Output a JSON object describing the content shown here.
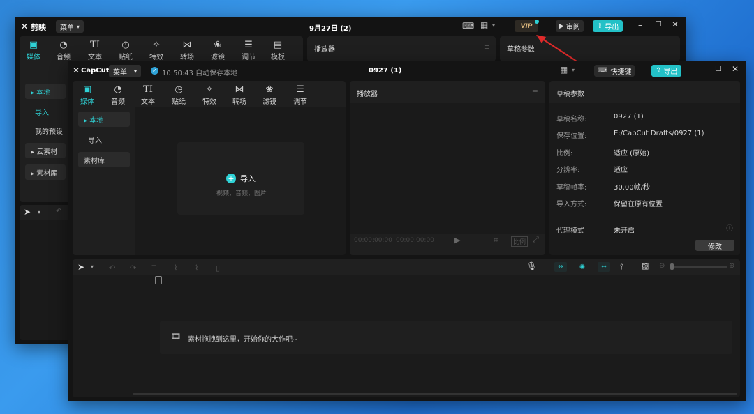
{
  "back_window": {
    "logo_text": "剪映",
    "menu_label": "菜单",
    "title": "9月27日 (2)",
    "vip_label": "VIP",
    "review_label": "审阅",
    "export_label": "导出",
    "tools": [
      {
        "label": "媒体",
        "active": true
      },
      {
        "label": "音频"
      },
      {
        "label": "文本"
      },
      {
        "label": "贴纸"
      },
      {
        "label": "特效"
      },
      {
        "label": "转场"
      },
      {
        "label": "滤镜"
      },
      {
        "label": "调节"
      },
      {
        "label": "模板"
      }
    ],
    "sidebar": [
      "▸ 本地",
      "导入",
      "我的预设",
      "▸ 云素材",
      "▸ 素材库"
    ],
    "player_title": "播放器",
    "draft_title": "草稿参数"
  },
  "front_window": {
    "logo_text": "CapCut",
    "menu_label": "菜单",
    "autosave_text": "10:50:43 自动保存本地",
    "title": "0927 (1)",
    "shortcut_label": "快捷键",
    "export_label": "导出",
    "tools": [
      {
        "label": "媒体",
        "active": true
      },
      {
        "label": "音频"
      },
      {
        "label": "文本"
      },
      {
        "label": "贴纸"
      },
      {
        "label": "特效"
      },
      {
        "label": "转场"
      },
      {
        "label": "滤镜"
      },
      {
        "label": "调节"
      }
    ],
    "sidebar": {
      "local": "▸ 本地",
      "import": "导入",
      "library": "素材库"
    },
    "import_box": {
      "label": "导入",
      "hint": "视频、音频、图片"
    },
    "player": {
      "title": "播放器",
      "time_current": "00:00:00:00",
      "time_total": "00:00:00:00",
      "ratio_label": "比例"
    },
    "draft": {
      "title": "草稿参数",
      "rows": [
        {
          "key": "草稿名称:",
          "value": "0927 (1)"
        },
        {
          "key": "保存位置:",
          "value": "E:/CapCut Drafts/0927 (1)"
        },
        {
          "key": "比例:",
          "value": "适应 (原始)"
        },
        {
          "key": "分辨率:",
          "value": "适应"
        },
        {
          "key": "草稿帧率:",
          "value": "30.00帧/秒"
        },
        {
          "key": "导入方式:",
          "value": "保留在原有位置"
        }
      ],
      "proxy_key": "代理模式",
      "proxy_value": "未开启",
      "modify_label": "修改"
    },
    "timeline": {
      "drop_hint": "素材拖拽到这里，开始你的大作吧~"
    }
  },
  "colors": {
    "accent": "#2fd2d6",
    "window_bg": "#131313",
    "panel_bg": "#1f1f1f"
  }
}
